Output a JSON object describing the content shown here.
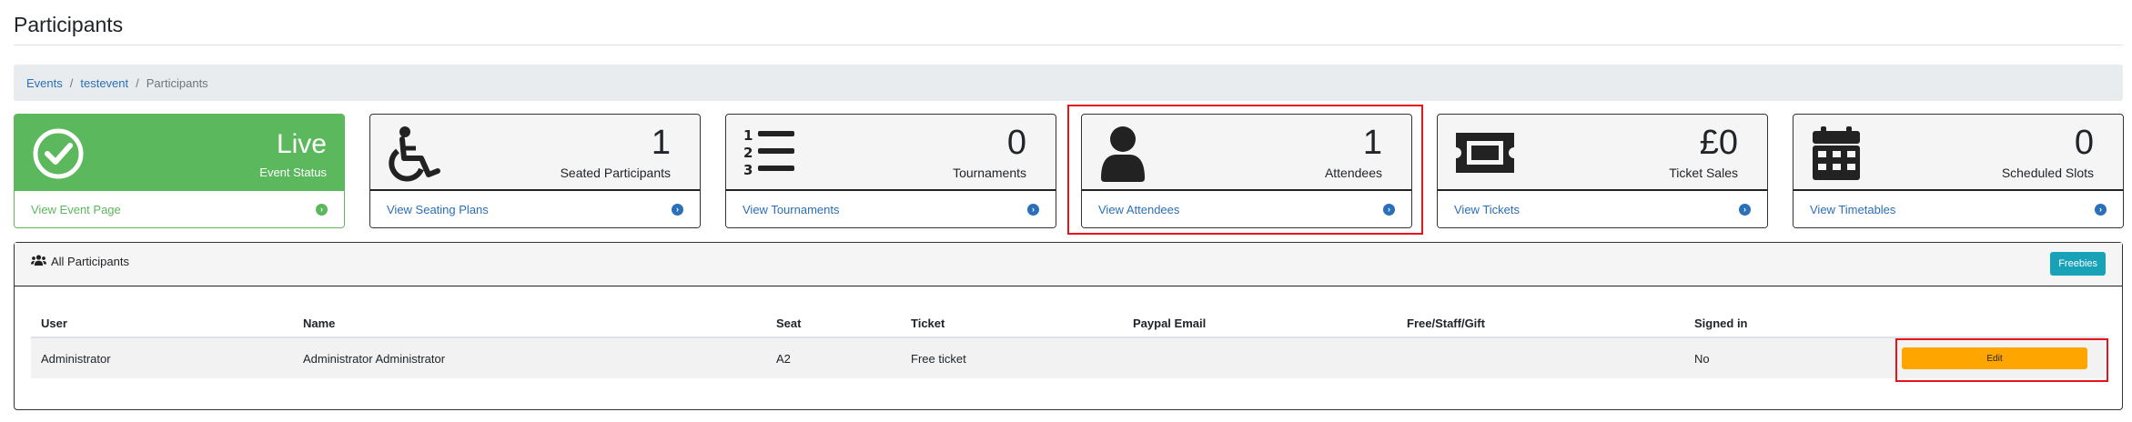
{
  "page": {
    "title": "Participants"
  },
  "breadcrumb": [
    {
      "label": "Events",
      "link": true
    },
    {
      "label": "testevent",
      "link": true
    },
    {
      "label": "Participants",
      "link": false
    }
  ],
  "breadcrumb_separator": "/",
  "cards": [
    {
      "value": "Live",
      "label": "Event Status",
      "link": "View Event Page",
      "icon": "check-circle-icon"
    },
    {
      "value": "1",
      "label": "Seated Participants",
      "link": "View Seating Plans",
      "icon": "wheelchair-icon"
    },
    {
      "value": "0",
      "label": "Tournaments",
      "link": "View Tournaments",
      "icon": "ordered-list-icon"
    },
    {
      "value": "1",
      "label": "Attendees",
      "link": "View Attendees",
      "icon": "user-icon"
    },
    {
      "value": "£0",
      "label": "Ticket Sales",
      "link": "View Tickets",
      "icon": "ticket-icon"
    },
    {
      "value": "0",
      "label": "Scheduled Slots",
      "link": "View Timetables",
      "icon": "calendar-icon"
    }
  ],
  "panel": {
    "title": "All Participants",
    "freebies_label": "Freebies",
    "columns": [
      "User",
      "Name",
      "Seat",
      "Ticket",
      "Paypal Email",
      "Free/Staff/Gift",
      "Signed in",
      ""
    ],
    "rows": [
      {
        "user": "Administrator",
        "name": "Administrator Administrator",
        "seat": "A2",
        "ticket": "Free ticket",
        "paypal_email": "",
        "free_staff_gift": "",
        "signed_in": "No",
        "action": "Edit"
      }
    ]
  },
  "colors": {
    "live_green": "#5cb85c",
    "link_blue": "#2a6fb8",
    "info_teal": "#17a2b8",
    "edit_orange": "#ffa500",
    "highlight_red": "#e8141c"
  }
}
